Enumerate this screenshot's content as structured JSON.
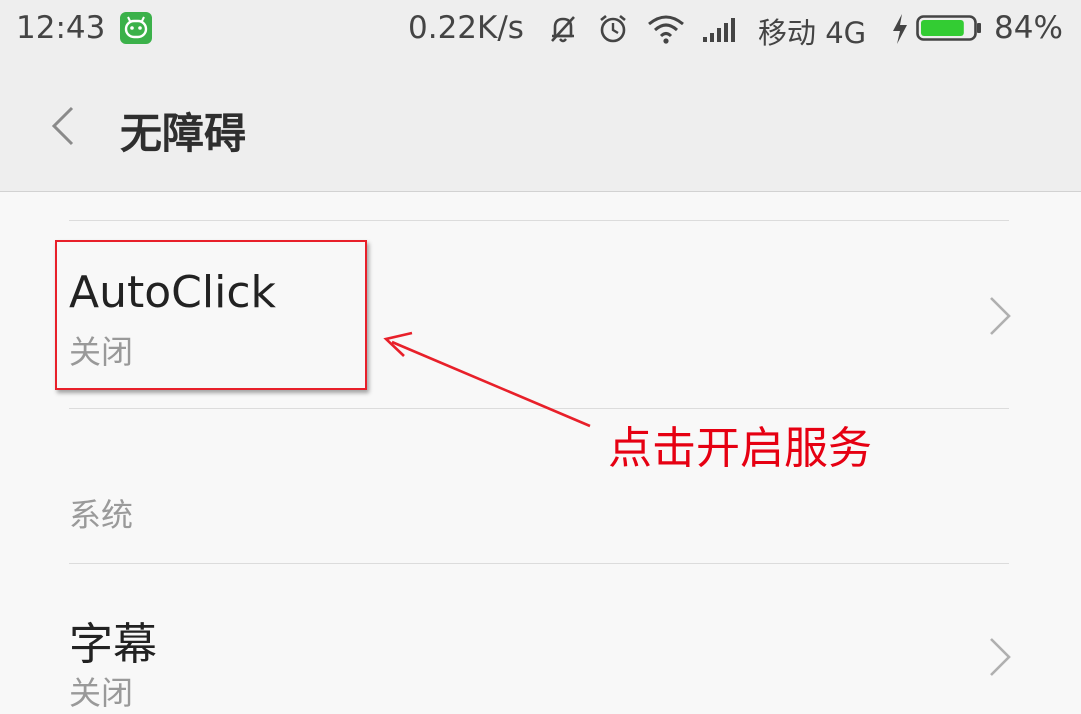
{
  "status_bar": {
    "time": "12:43",
    "network_speed": "0.22K/s",
    "carrier": "移动 4G",
    "battery_percent": "84%",
    "battery_level": 0.84,
    "battery_color": "#33cc33",
    "icons": [
      "app-icon",
      "silent-icon",
      "alarm-icon",
      "wifi-icon",
      "signal-icon",
      "charging-icon",
      "battery-icon"
    ]
  },
  "header": {
    "title": "无障碍"
  },
  "items": [
    {
      "title": "AutoClick",
      "subtitle": "关闭"
    }
  ],
  "section": {
    "label": "系统"
  },
  "system_items": [
    {
      "title": "字幕",
      "subtitle": "关闭"
    }
  ],
  "annotation": {
    "text": "点击开启服务",
    "color": "#e60012"
  }
}
